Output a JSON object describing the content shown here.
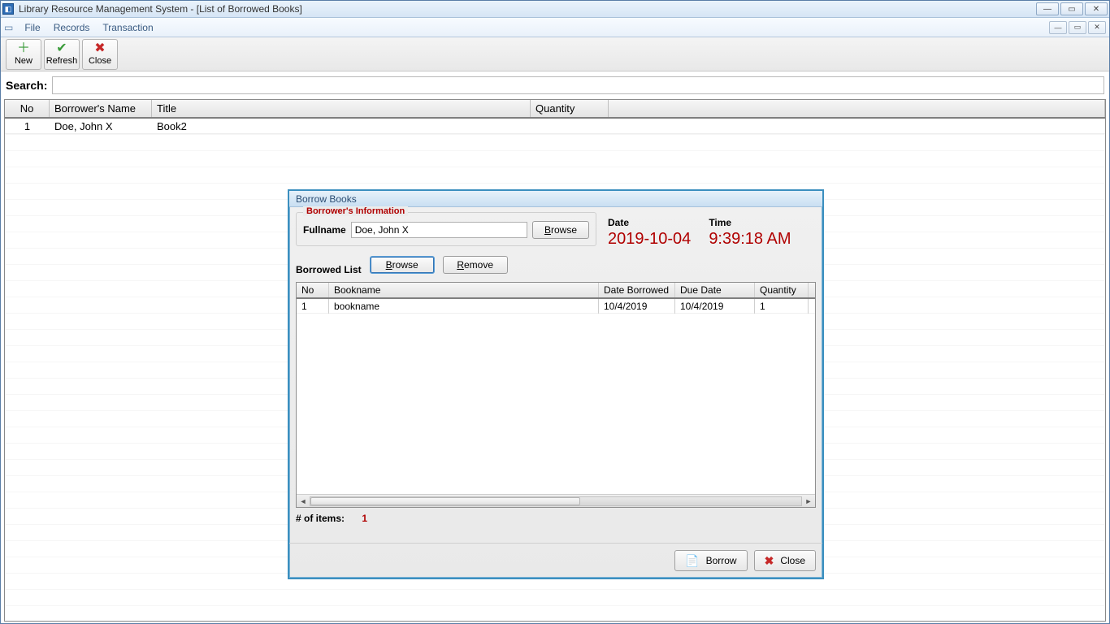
{
  "window": {
    "title": "Library Resource Management System - [List of Borrowed Books]"
  },
  "menubar": {
    "file": "File",
    "records": "Records",
    "transaction": "Transaction"
  },
  "toolbar": {
    "new_label": "New",
    "refresh_label": "Refresh",
    "close_label": "Close"
  },
  "search": {
    "label": "Search:",
    "value": ""
  },
  "main_grid": {
    "headers": {
      "no": "No",
      "name": "Borrower's Name",
      "title": "Title",
      "qty": "Quantity"
    },
    "rows": [
      {
        "no": "1",
        "name": "Doe, John X",
        "title": "Book2",
        "qty": ""
      }
    ]
  },
  "dialog": {
    "title": "Borrow Books",
    "borrower_legend": "Borrower's Information",
    "fullname_label": "Fullname",
    "fullname_value": "Doe, John X",
    "browse_label": "Browse",
    "date_label": "Date",
    "date_value": "2019-10-04",
    "time_label": "Time",
    "time_value": "9:39:18 AM",
    "borrowed_list_label": "Borrowed List",
    "browse2_label": "Browse",
    "remove_label": "Remove",
    "sub_headers": {
      "no": "No",
      "book": "Bookname",
      "db": "Date Borrowed",
      "due": "Due Date",
      "qty": "Quantity"
    },
    "sub_rows": [
      {
        "no": "1",
        "book": "bookname",
        "db": "10/4/2019",
        "due": "10/4/2019",
        "qty": "1"
      }
    ],
    "items_label": "# of items:",
    "items_count": "1",
    "borrow_btn": "Borrow",
    "close_btn": "Close"
  }
}
